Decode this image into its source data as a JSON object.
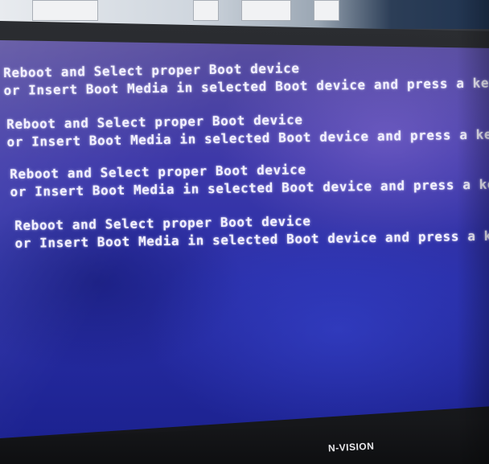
{
  "boot_screen": {
    "messages": [
      {
        "line1": "Reboot and Select proper Boot device",
        "line2": "or Insert Boot Media in selected Boot device and press a key"
      },
      {
        "line1": "Reboot and Select proper Boot device",
        "line2": "or Insert Boot Media in selected Boot device and press a key"
      },
      {
        "line1": "Reboot and Select proper Boot device",
        "line2": "or Insert Boot Media in selected Boot device and press a key"
      },
      {
        "line1": "Reboot and Select proper Boot device",
        "line2": "or Insert Boot Media in selected Boot device and press a key."
      }
    ]
  },
  "monitor": {
    "brand": "N-VISION"
  },
  "colors": {
    "screen_blue": "#2a2fa8",
    "text": "#f2f0ff",
    "bezel": "#1c1d21"
  }
}
